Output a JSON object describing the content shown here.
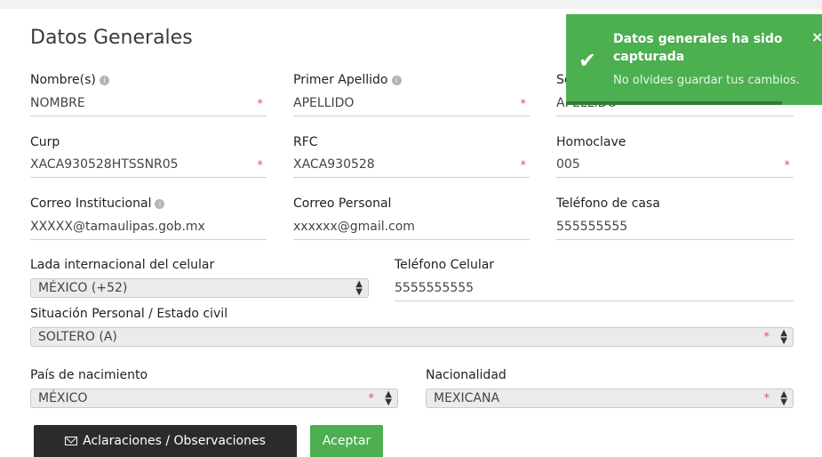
{
  "title": "Datos Generales",
  "fields": {
    "nombre": {
      "label": "Nombre(s)",
      "value": "NOMBRE",
      "required": "*"
    },
    "primer_apellido": {
      "label": "Primer Apellido",
      "value": "APELLIDO",
      "required": "*"
    },
    "segundo_apellido": {
      "label": "Se",
      "value": "APELLIDO"
    },
    "curp": {
      "label": "Curp",
      "value": "XACA930528HTSSNR05",
      "required": "*"
    },
    "rfc": {
      "label": "RFC",
      "value": "XACA930528",
      "required": "*"
    },
    "homoclave": {
      "label": "Homoclave",
      "value": "005",
      "required": "*"
    },
    "correo_institucional": {
      "label": "Correo Institucional",
      "value": "XXXXX@tamaulipas.gob.mx"
    },
    "correo_personal": {
      "label": "Correo Personal",
      "value": "xxxxxx@gmail.com"
    },
    "telefono_casa": {
      "label": "Teléfono de casa",
      "value": "555555555"
    },
    "lada": {
      "label": "Lada internacional del celular",
      "value": "MÉXICO (+52)"
    },
    "telefono_celular": {
      "label": "Teléfono Celular",
      "value": "5555555555"
    },
    "estado_civil": {
      "label": "Situación Personal / Estado civil",
      "value": "SOLTERO (A)",
      "required": "*"
    },
    "pais_nacimiento": {
      "label": "País de nacimiento",
      "value": "MÉXICO",
      "required": "*"
    },
    "nacionalidad": {
      "label": "Nacionalidad",
      "value": "MEXICANA",
      "required": "*"
    }
  },
  "buttons": {
    "aclaraciones": "Aclaraciones / Observaciones",
    "aceptar": "Aceptar"
  },
  "toast": {
    "title": "Datos generales ha sido capturada",
    "message": "No olvides guardar tus cambios.",
    "close": "×",
    "check": "✔"
  },
  "icons": {
    "info": "info-icon",
    "envelope": "envelope-icon",
    "select_arrows": "updown-arrows-icon",
    "check": "check-icon",
    "close": "close-icon"
  },
  "colors": {
    "success": "#4caf50",
    "required": "#e05555",
    "dark_button": "#2b2b2b"
  }
}
